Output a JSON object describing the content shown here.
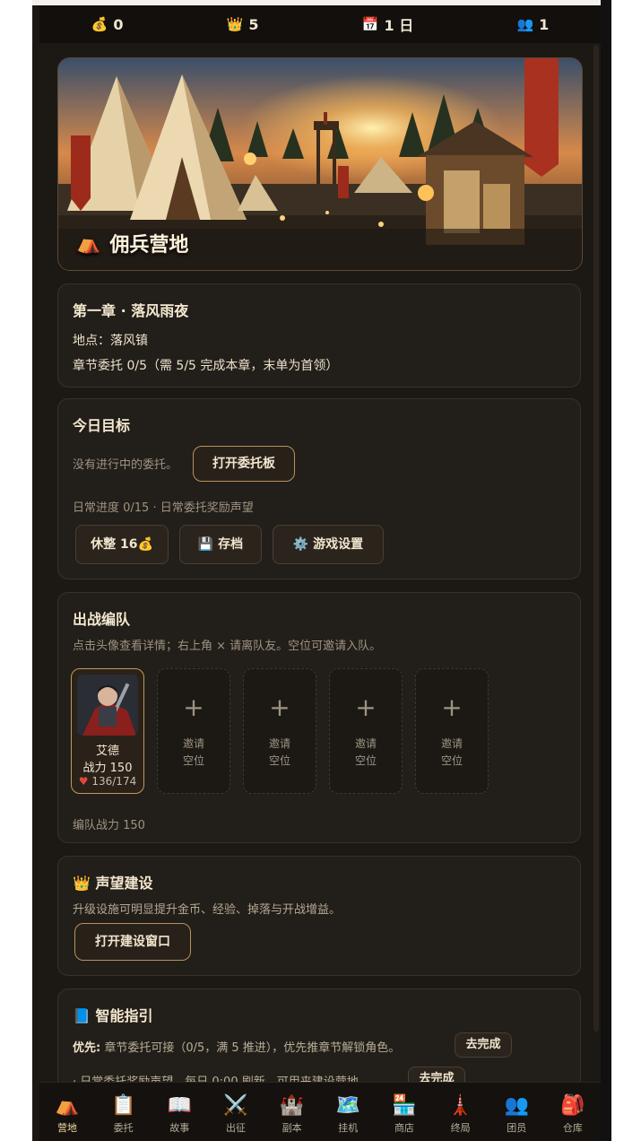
{
  "topbar": {
    "gold": {
      "icon": "💰",
      "value": "0"
    },
    "fame": {
      "icon": "👑",
      "value": "5"
    },
    "day": {
      "icon": "📅",
      "value": "1 日"
    },
    "members": {
      "icon": "👥",
      "value": "1"
    }
  },
  "banner": {
    "title": "佣兵营地",
    "icon": "⛺"
  },
  "chapter": {
    "title": "第一章 · 落风雨夜",
    "location": "地点：落风镇",
    "progress": "章节委托 0/5（需 5/5 完成本章，末单为首领）"
  },
  "today": {
    "title": "今日目标",
    "no_task": "没有进行中的委托。",
    "open_board": "打开委托板",
    "daily": "日常进度 0/15 · 日常委托奖励声望",
    "rest": "休整 16💰",
    "save": "存档",
    "save_icon": "💾",
    "settings": "游戏设置",
    "settings_icon": "⚙️"
  },
  "party": {
    "title": "出战编队",
    "hint": "点击头像查看详情；右上角 × 请离队友。空位可邀请入队。",
    "member": {
      "name": "艾德",
      "power": "战力 150",
      "hp": "136/174",
      "hp_icon": "♥"
    },
    "empty_plus": "+",
    "invite_line1": "邀请",
    "invite_line2": "空位",
    "total": "编队战力 150"
  },
  "build": {
    "icon": "👑",
    "title": "声望建设",
    "desc": "升级设施可明显提升金币、经验、掉落与开战增益。",
    "button": "打开建设窗口"
  },
  "guide": {
    "icon": "📘",
    "title": "智能指引",
    "prefix": "优先:",
    "line1": "章节委托可接（0/5，满 5 推进），优先推章节解锁角色。",
    "go1": "去完成",
    "line2": "· 日常委托奖励声望，每日 0:00 刷新，可用来建设营地。",
    "go2": "去完成"
  },
  "nav": [
    {
      "label": "营地",
      "icon": "⛺"
    },
    {
      "label": "委托",
      "icon": "📋"
    },
    {
      "label": "故事",
      "icon": "📖"
    },
    {
      "label": "出征",
      "icon": "⚔️"
    },
    {
      "label": "副本",
      "icon": "🏰"
    },
    {
      "label": "挂机",
      "icon": "🗺️"
    },
    {
      "label": "商店",
      "icon": "🏪"
    },
    {
      "label": "终局",
      "icon": "🗼"
    },
    {
      "label": "团员",
      "icon": "👥"
    },
    {
      "label": "仓库",
      "icon": "🎒"
    }
  ],
  "colors": {
    "accent": "#c19a5e",
    "bg": "#1c1814",
    "card": "#221e19",
    "hp": "#e0473d"
  }
}
